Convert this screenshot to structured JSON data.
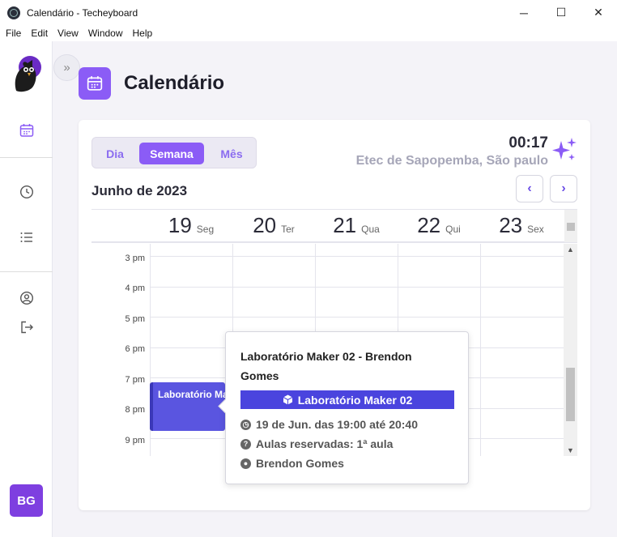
{
  "window": {
    "title": "Calendário - Techeyboard",
    "controls": [
      "─",
      "☐",
      "✕"
    ]
  },
  "menu": [
    "File",
    "Edit",
    "View",
    "Window",
    "Help"
  ],
  "sidebar": {
    "avatar_initials": "BG",
    "expand_label": "»"
  },
  "page": {
    "title": "Calendário"
  },
  "view_switch": {
    "day": "Dia",
    "week": "Semana",
    "month": "Mês",
    "active": "week"
  },
  "clock": {
    "time": "00:17",
    "location": "Etec de Sapopemba, São paulo"
  },
  "calendar": {
    "month_label": "Junho de 2023",
    "prev": "‹",
    "next": "›",
    "days": [
      {
        "num": "19",
        "name": "Seg"
      },
      {
        "num": "20",
        "name": "Ter"
      },
      {
        "num": "21",
        "name": "Qua"
      },
      {
        "num": "22",
        "name": "Qui"
      },
      {
        "num": "23",
        "name": "Sex"
      }
    ],
    "hours": [
      "3 pm",
      "4 pm",
      "5 pm",
      "6 pm",
      "7 pm",
      "8 pm",
      "9 pm"
    ]
  },
  "event": {
    "label": "Laboratório Maker 02"
  },
  "popover": {
    "title": "Laboratório Maker 02 - Brendon Gomes",
    "tag": "Laboratório Maker 02",
    "time": "19 de Jun. das 19:00 até 20:40",
    "reserved": "Aulas reservadas: 1ª aula",
    "person": "Brendon Gomes"
  },
  "colors": {
    "accent": "#8b5cf6",
    "event": "#5a55e0",
    "tag": "#4a44de",
    "avatar": "#7e3fe0"
  }
}
